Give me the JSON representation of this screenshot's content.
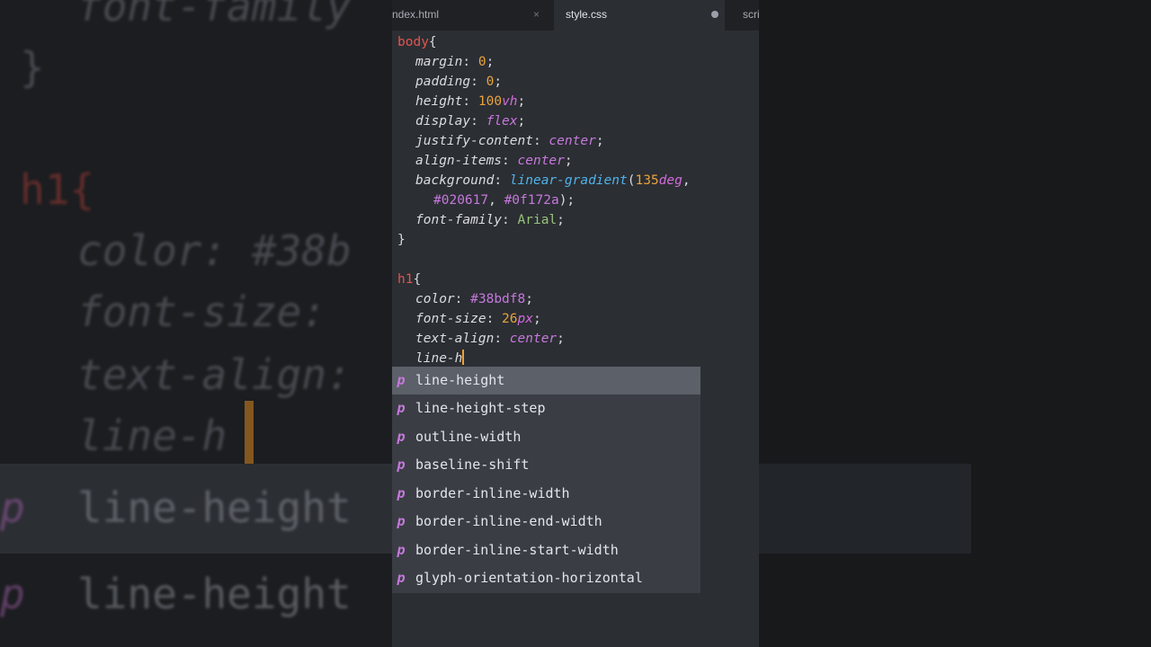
{
  "tabs": [
    {
      "label": "ndex.html",
      "active": false,
      "close": "×"
    },
    {
      "label": "style.css",
      "active": true,
      "modified": true
    },
    {
      "label": "scri",
      "active": false
    }
  ],
  "code": {
    "l1_sel": "body",
    "l1_brace": "{",
    "margin_prop": "margin",
    "margin_val": "0",
    "padding_prop": "padding",
    "padding_val": "0",
    "height_prop": "height",
    "height_num": "100",
    "height_unit": "vh",
    "display_prop": "display",
    "display_val": "flex",
    "jc_prop": "justify-content",
    "jc_val": "center",
    "ai_prop": "align-items",
    "ai_val": "center",
    "bg_prop": "background",
    "bg_fn": "linear-gradient",
    "bg_num": "135",
    "bg_unit": "deg",
    "bg_c1": "#020617",
    "bg_c2": "#0f172a",
    "ff_prop": "font-family",
    "ff_val": "Arial",
    "close1": "}",
    "h1_sel": "h1",
    "h1_brace": "{",
    "color_prop": "color",
    "color_val": "#38bdf8",
    "fs_prop": "font-size",
    "fs_num": "26",
    "fs_unit": "px",
    "ta_prop": "text-align",
    "ta_val": "center",
    "typing": "line-h"
  },
  "autocomplete": {
    "kind": "p",
    "items": [
      "line-height",
      "line-height-step",
      "outline-width",
      "baseline-shift",
      "border-inline-width",
      "border-inline-end-width",
      "border-inline-start-width",
      "glyph-orientation-horizontal"
    ]
  },
  "background_zoom": {
    "l1": "font-family",
    "l2": "}",
    "l3": "h1{",
    "l4": "color: #38b",
    "l5": "font-size:",
    "l6": "text-align:",
    "l7": "line-h",
    "l8": "line-height",
    "l9": "line-height",
    "kind": "p"
  }
}
